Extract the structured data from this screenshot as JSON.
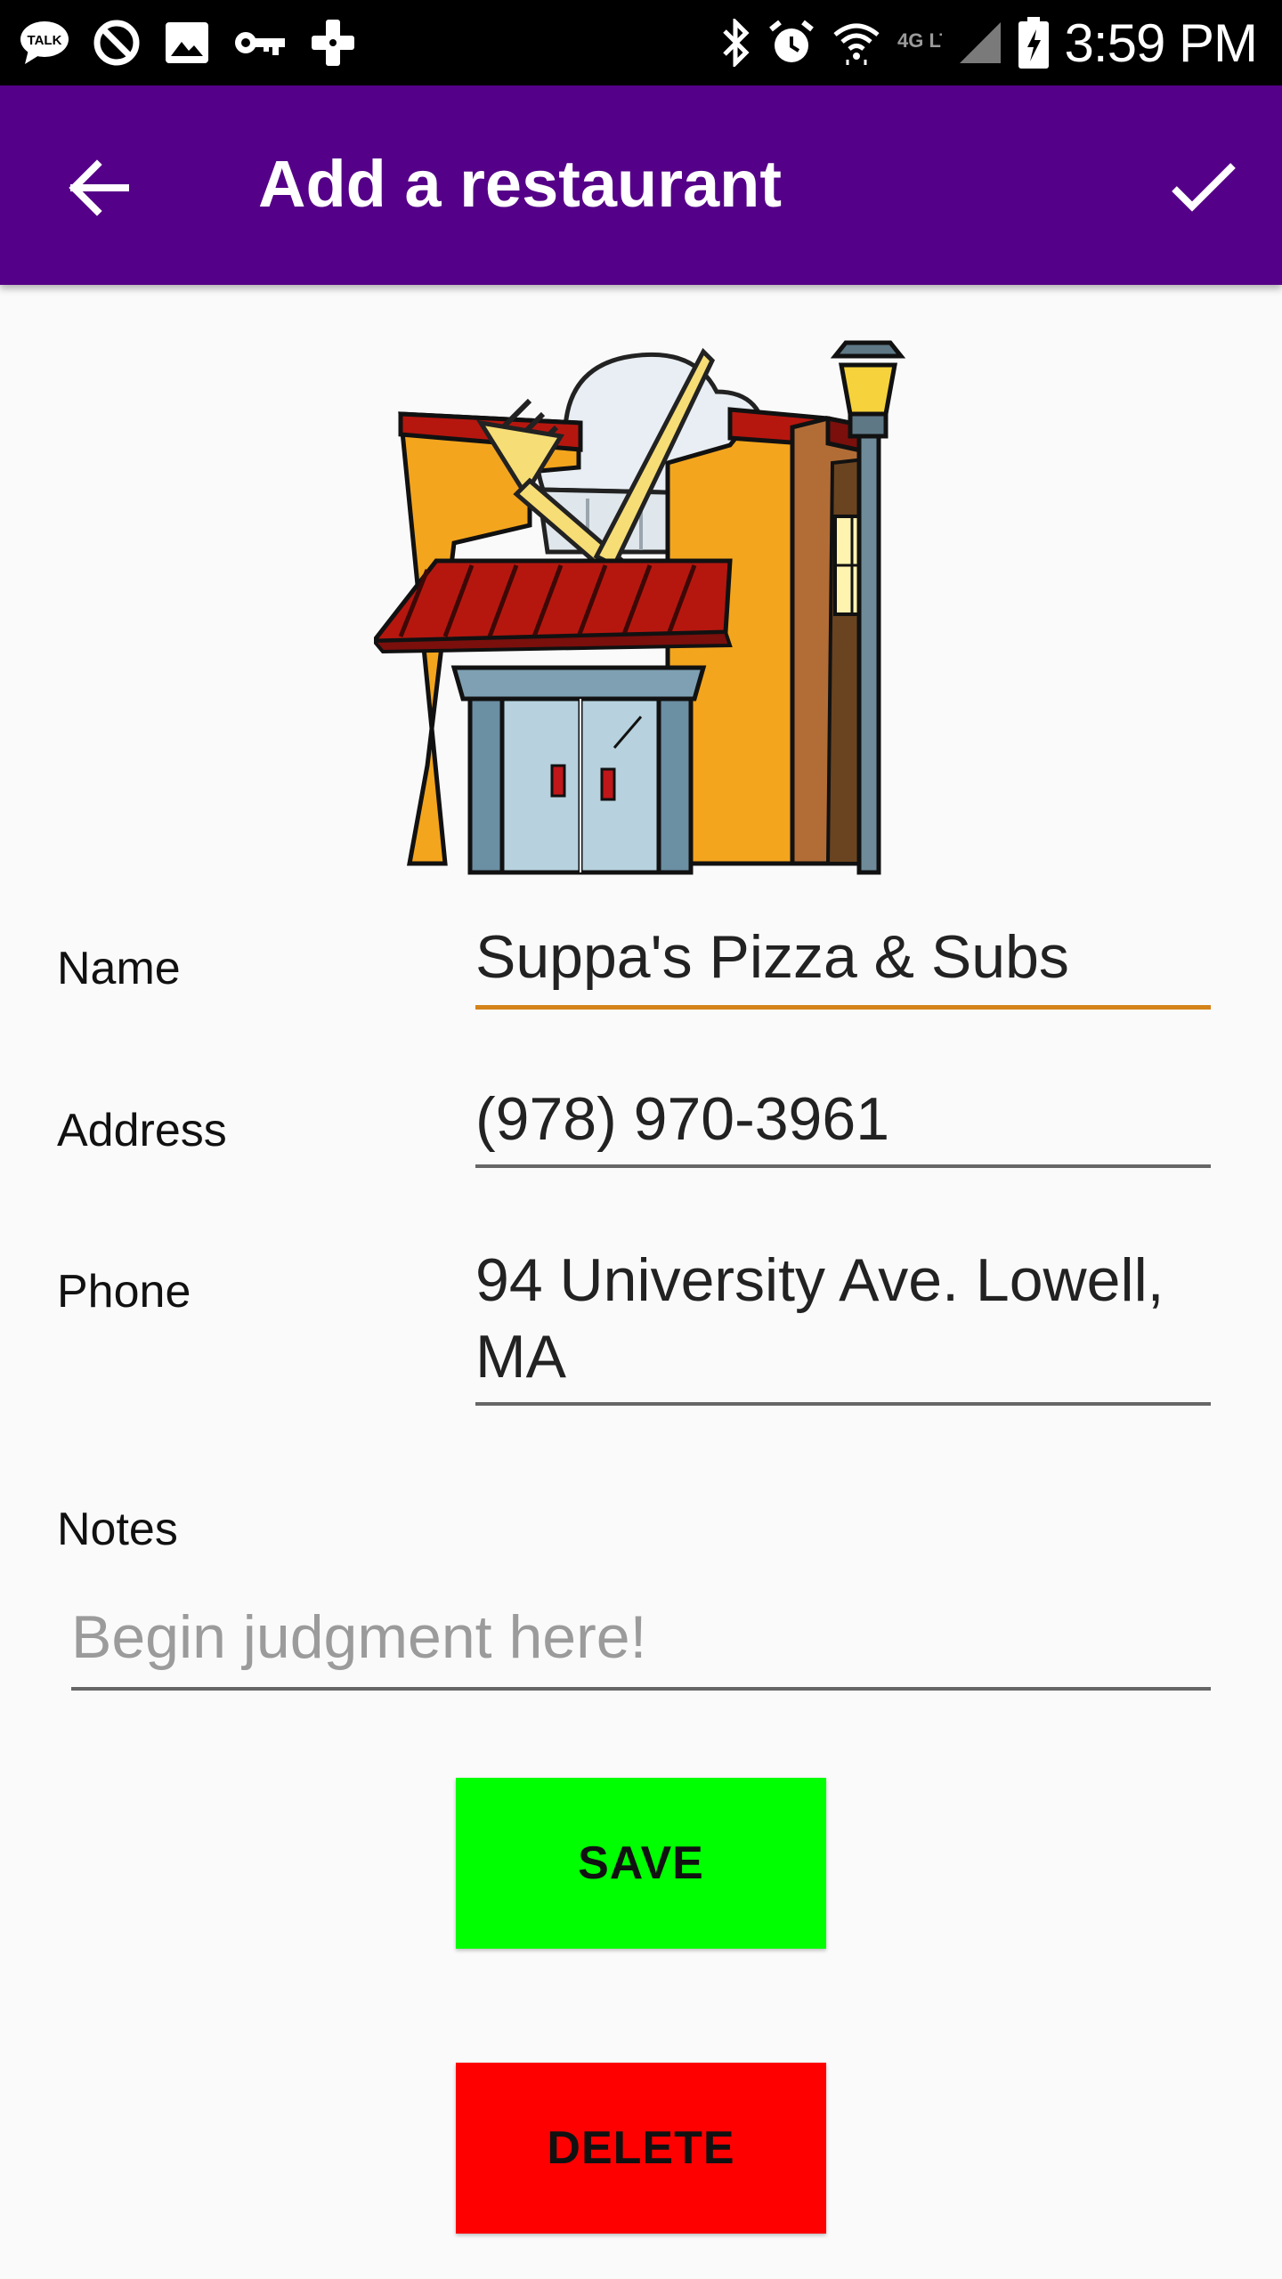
{
  "status_bar": {
    "time": "3:59 PM",
    "network_label": "4G LTE",
    "left_icons": [
      "kakaotalk-icon",
      "do-not-disturb-icon",
      "image-icon",
      "vpn-key-icon",
      "game-controller-icon"
    ],
    "right_icons": [
      "bluetooth-icon",
      "alarm-icon",
      "wifi-icon",
      "network-label",
      "cell-signal-icon",
      "battery-charging-icon"
    ],
    "kakaotalk_text": "TALK"
  },
  "app_bar": {
    "title": "Add a restaurant",
    "back_icon": "arrow-back-icon",
    "confirm_icon": "check-icon",
    "color": "#550088"
  },
  "illustration": {
    "name": "restaurant-storefront-illustration"
  },
  "form": {
    "name_label": "Name",
    "name_value": "Suppa's Pizza & Subs",
    "address_label": "Address",
    "address_value": "(978) 970-3961",
    "phone_label": "Phone",
    "phone_value": "94 University Ave. Lowell, MA",
    "notes_label": "Notes",
    "notes_placeholder": "Begin judgment here!",
    "active_underline_color": "#d4831a"
  },
  "buttons": {
    "save_label": "SAVE",
    "save_color": "#00ff00",
    "delete_label": "DELETE",
    "delete_color": "#ff0000"
  }
}
